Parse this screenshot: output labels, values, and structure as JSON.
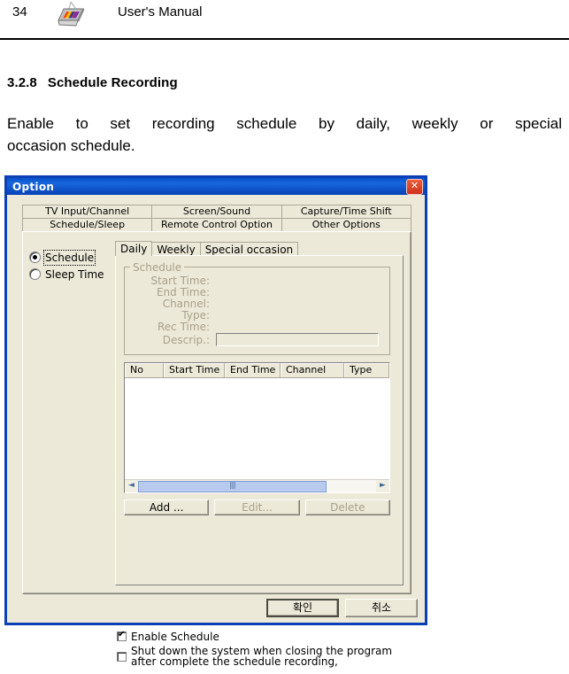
{
  "page": {
    "number": "34",
    "title": "User's Manual",
    "icon": "tv-monitor-icon"
  },
  "section": {
    "number": "3.2.8",
    "heading": "Schedule Recording",
    "paragraph_line1": "Enable to set recording schedule by daily, weekly or special",
    "paragraph_line2": "occasion schedule."
  },
  "dialog": {
    "title": "Option",
    "close_label": "✕",
    "outer_tabs_row1": [
      {
        "label": "TV Input/Channel",
        "selected": false
      },
      {
        "label": "Screen/Sound",
        "selected": false
      },
      {
        "label": "Capture/Time Shift",
        "selected": false
      }
    ],
    "outer_tabs_row2": [
      {
        "label": "Schedule/Sleep",
        "selected": true
      },
      {
        "label": "Remote Control Option",
        "selected": false
      },
      {
        "label": "Other Options",
        "selected": false
      }
    ],
    "mode_radios": [
      {
        "label": "Schedule",
        "selected": true,
        "focused": true
      },
      {
        "label": "Sleep Time",
        "selected": false,
        "focused": false
      }
    ],
    "inner_tabs": [
      {
        "label": "Daily",
        "selected": true
      },
      {
        "label": "Weekly",
        "selected": false
      },
      {
        "label": "Special occasion",
        "selected": false
      }
    ],
    "schedule_group": {
      "title": "Schedule",
      "fields": [
        {
          "label": "Start Time:",
          "value": ""
        },
        {
          "label": "End Time:",
          "value": ""
        },
        {
          "label": "Channel:",
          "value": ""
        },
        {
          "label": "Type:",
          "value": ""
        },
        {
          "label": "Rec Time:",
          "value": ""
        },
        {
          "label": "Descrip.:",
          "value": ""
        }
      ],
      "descrip_value": ""
    },
    "list_view": {
      "columns": [
        "No",
        "Start Time",
        "End Time",
        "Channel",
        "Type"
      ],
      "rows": []
    },
    "scrollbar": {
      "left_arrow": "◄",
      "right_arrow": "►"
    },
    "action_buttons": [
      {
        "label": "Add ...",
        "accel": "A",
        "disabled": false
      },
      {
        "label": "Edit...",
        "accel": "E",
        "disabled": true
      },
      {
        "label": "Delete",
        "accel": "D",
        "disabled": true
      }
    ],
    "checkboxes": [
      {
        "label_line1": "Enable Schedule",
        "label_line2": "",
        "checked": true
      },
      {
        "label_line1": "Shut down the system when closing the program",
        "label_line2": "after complete the schedule recording,",
        "checked": false
      }
    ],
    "footer_buttons": [
      {
        "label": "확인",
        "default": true
      },
      {
        "label": "취소",
        "default": false
      }
    ],
    "colors": {
      "titlebar": "#0b3fb5",
      "face": "#ece9d8",
      "disabled_text": "#a9a08c",
      "scroll_thumb": "#b8cbee"
    }
  }
}
